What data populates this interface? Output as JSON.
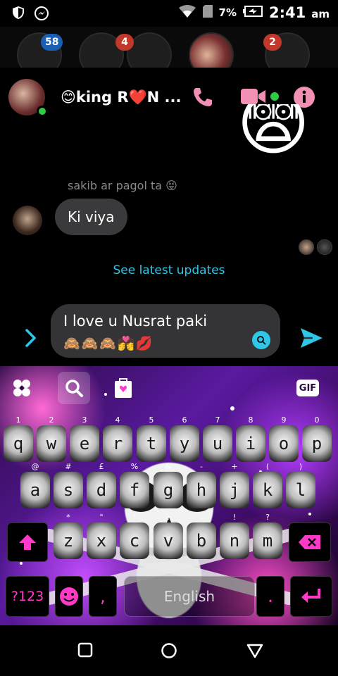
{
  "status_bar": {
    "battery_pct": "7%",
    "time": "2:41",
    "ampm": "am",
    "icons": [
      "shield-icon",
      "messenger-icon",
      "wifi-icon",
      "sim-icon",
      "battery-charging-icon"
    ]
  },
  "chat_heads": {
    "badges": [
      "58",
      "4",
      "2"
    ]
  },
  "header": {
    "contact_name": "😊king R❤️N ...",
    "online": true,
    "icons": [
      "phone-icon",
      "video-icon",
      "info-icon"
    ],
    "accent_color": "#f28fb5"
  },
  "messages": {
    "big_emoji": "😨",
    "reply_context": "sakib ar pagol ta 😝",
    "bubble_text": "Ki viya",
    "latest_link": "See latest updates"
  },
  "composer": {
    "text": "I love u Nusrat paki",
    "emoji_line": "🙈🙈🙈💏💋"
  },
  "keyboard": {
    "toolbar_icons": [
      "apps-icon",
      "search-icon",
      "theme-store-icon",
      "gif-icon"
    ],
    "gif_label": "GIF",
    "row1": [
      {
        "k": "q",
        "h": "1"
      },
      {
        "k": "w",
        "h": "2"
      },
      {
        "k": "e",
        "h": "3"
      },
      {
        "k": "r",
        "h": "4"
      },
      {
        "k": "t",
        "h": "5"
      },
      {
        "k": "y",
        "h": "6"
      },
      {
        "k": "u",
        "h": "7"
      },
      {
        "k": "i",
        "h": "8"
      },
      {
        "k": "o",
        "h": "9"
      },
      {
        "k": "p",
        "h": "0"
      }
    ],
    "row2": [
      {
        "k": "a",
        "h": "@"
      },
      {
        "k": "s",
        "h": "#"
      },
      {
        "k": "d",
        "h": "£"
      },
      {
        "k": "f",
        "h": "%"
      },
      {
        "k": "g",
        "h": "&"
      },
      {
        "k": "h",
        "h": "-"
      },
      {
        "k": "j",
        "h": "+"
      },
      {
        "k": "k",
        "h": "("
      },
      {
        "k": "l",
        "h": ")"
      }
    ],
    "row3": [
      {
        "k": "z",
        "h": "*"
      },
      {
        "k": "x",
        "h": "\""
      },
      {
        "k": "c",
        "h": "'"
      },
      {
        "k": "v",
        "h": ":"
      },
      {
        "k": "b",
        "h": ";"
      },
      {
        "k": "n",
        "h": "!"
      },
      {
        "k": "m",
        "h": "?"
      }
    ],
    "symbols_label": "?123",
    "comma": ",",
    "space_label": "English",
    "period": ".",
    "theme_accent": "#ff39c8"
  },
  "navbar": {
    "icons": [
      "recents-icon",
      "home-icon",
      "back-icon"
    ]
  }
}
